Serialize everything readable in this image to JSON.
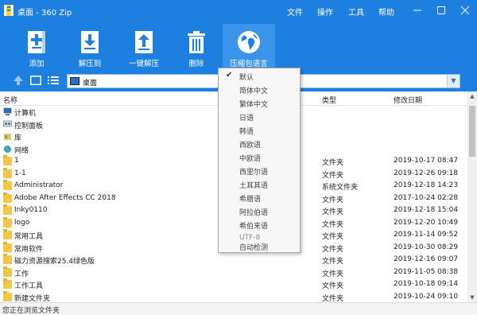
{
  "window": {
    "title": "桌面 - 360 Zip",
    "menus": [
      "文件",
      "操作",
      "工具",
      "帮助"
    ]
  },
  "toolbar": [
    {
      "label": "添加",
      "icon": "add-archive-icon"
    },
    {
      "label": "解压到",
      "icon": "extract-to-icon"
    },
    {
      "label": "一键解压",
      "icon": "one-click-extract-icon"
    },
    {
      "label": "删除",
      "icon": "trash-icon"
    },
    {
      "label": "压缩包语言",
      "icon": "globe-icon"
    }
  ],
  "address": {
    "path": "桌面"
  },
  "columns": {
    "name": "名称",
    "type": "类型",
    "modified": "修改日期"
  },
  "rows": [
    {
      "name": "计算机",
      "icon": "computer-icon",
      "type": "",
      "date": ""
    },
    {
      "name": "控制面板",
      "icon": "control-panel-icon",
      "type": "",
      "date": ""
    },
    {
      "name": "库",
      "icon": "library-icon",
      "type": "",
      "date": ""
    },
    {
      "name": "网络",
      "icon": "network-icon",
      "type": "",
      "date": ""
    },
    {
      "name": "1",
      "icon": "folder-icon",
      "type": "文件夹",
      "date": "2019-10-17 08:47"
    },
    {
      "name": "1-1",
      "icon": "folder-icon",
      "type": "文件夹",
      "date": "2019-12-26 09:18"
    },
    {
      "name": "Administrator",
      "icon": "folder-icon",
      "type": "系统文件夹",
      "date": "2019-12-18 14:23"
    },
    {
      "name": "Adobe After Effects CC 2018",
      "icon": "folder-icon",
      "type": "文件夹",
      "date": "2017-10-24 02:28"
    },
    {
      "name": "Inky0110",
      "icon": "folder-icon",
      "type": "文件夹",
      "date": "2019-12-18 15:04"
    },
    {
      "name": "logo",
      "icon": "folder-icon",
      "type": "文件夹",
      "date": "2019-12-20 10:49"
    },
    {
      "name": "常用工具",
      "icon": "folder-icon",
      "type": "文件夹",
      "date": "2019-11-14 09:52"
    },
    {
      "name": "常用软件",
      "icon": "folder-icon",
      "type": "文件夹",
      "date": "2019-10-30 08:29"
    },
    {
      "name": "磁力资源搜索25.4绿色版",
      "icon": "folder-icon",
      "type": "文件夹",
      "date": "2019-12-16 09:07"
    },
    {
      "name": "工作",
      "icon": "folder-icon",
      "type": "文件夹",
      "date": "2019-11-05 08:38"
    },
    {
      "name": "工作工具",
      "icon": "folder-icon",
      "type": "文件夹",
      "date": "2019-10-18 09:14"
    },
    {
      "name": "新建文件夹",
      "icon": "folder-icon",
      "type": "文件夹",
      "date": "2019-10-24 09:10"
    }
  ],
  "language_menu": {
    "checked": "默认",
    "items": [
      "默认",
      "简体中文",
      "繁体中文",
      "日语",
      "韩语",
      "西欧语",
      "中欧语",
      "西里尔语",
      "土耳其语",
      "希腊语",
      "阿拉伯语",
      "希伯来语",
      "UTF-8",
      "自动检测"
    ]
  },
  "status": {
    "text": "您正在浏览文件夹"
  },
  "colors": {
    "accent": "#1d7fe0",
    "folder": "#f2c649"
  }
}
